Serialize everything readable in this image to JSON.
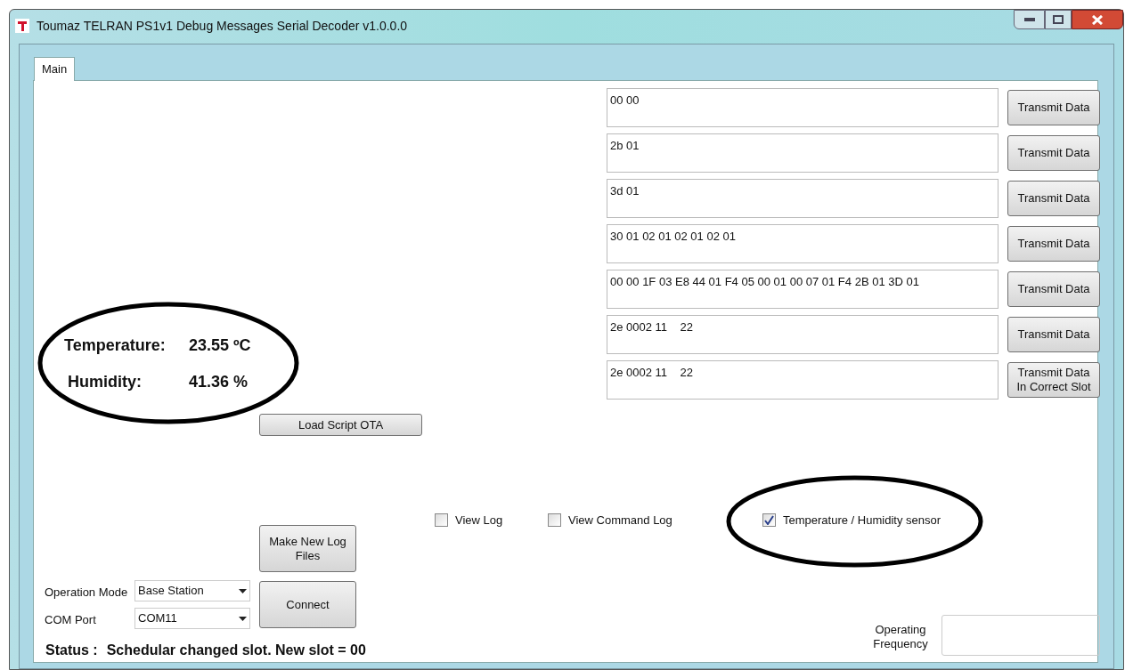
{
  "window": {
    "title": "Toumaz TELRAN PS1v1 Debug Messages Serial Decoder v1.0.0.0"
  },
  "tabs": [
    {
      "label": "Main",
      "selected": true
    }
  ],
  "transmit_rows": [
    {
      "value": "00 00",
      "button": "Transmit Data"
    },
    {
      "value": "2b 01",
      "button": "Transmit Data"
    },
    {
      "value": "3d 01",
      "button": "Transmit Data"
    },
    {
      "value": "30 01 02 01 02 01 02 01",
      "button": "Transmit Data"
    },
    {
      "value": "00 00 1F 03 E8 44 01 F4 05 00 01 00 07 01 F4 2B 01 3D 01",
      "button": "Transmit Data"
    },
    {
      "value": "2e 0002 11    22",
      "button": "Transmit Data"
    },
    {
      "value": "2e 0002 11    22",
      "button": "Transmit Data In Correct Slot"
    }
  ],
  "readings": [
    {
      "label": "Temperature:",
      "value": "23.55 ºC"
    },
    {
      "label": "Humidity:",
      "value": "41.36 %"
    }
  ],
  "load_script_button": "Load Script OTA",
  "checkboxes": [
    {
      "label": "View Log",
      "checked": false
    },
    {
      "label": "View Command Log",
      "checked": false
    },
    {
      "label": "Temperature / Humidity sensor",
      "checked": true
    }
  ],
  "make_log_button": "Make New Log Files",
  "connect_button": "Connect",
  "operation_mode": {
    "label": "Operation Mode",
    "value": "Base Station"
  },
  "com_port": {
    "label": "COM Port",
    "value": "COM11"
  },
  "status": {
    "label": "Status :",
    "text": "Schedular changed slot. New slot = 00"
  },
  "operating_frequency": {
    "label": "Operating Frequency"
  }
}
